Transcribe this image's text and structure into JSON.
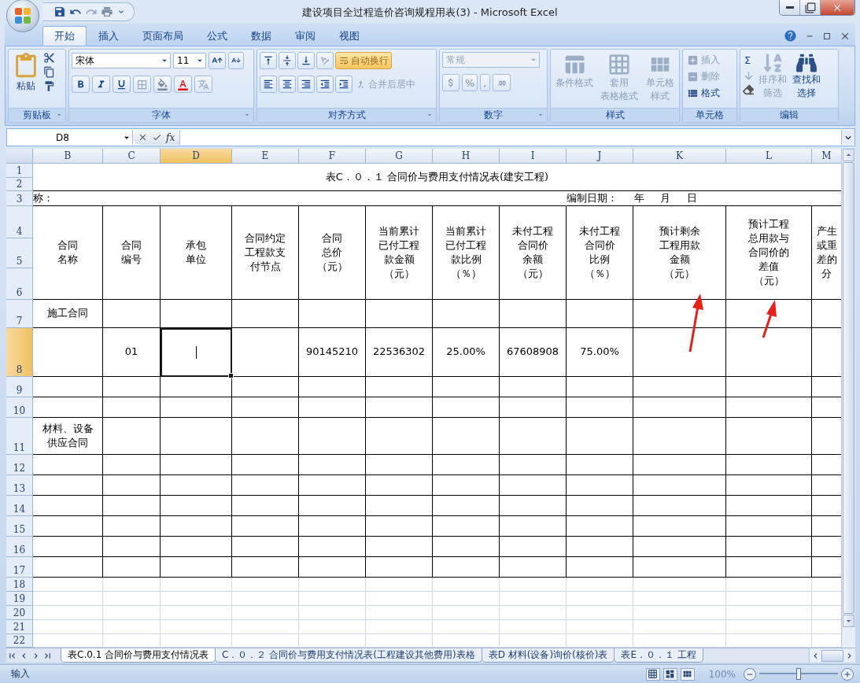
{
  "window": {
    "title": "建设项目全过程造价咨询规程用表(3) - Microsoft Excel"
  },
  "ribbon_tabs": [
    {
      "label": "开始",
      "selected": true
    },
    {
      "label": "插入",
      "selected": false
    },
    {
      "label": "页面布局",
      "selected": false
    },
    {
      "label": "公式",
      "selected": false
    },
    {
      "label": "数据",
      "selected": false
    },
    {
      "label": "审阅",
      "selected": false
    },
    {
      "label": "视图",
      "selected": false
    }
  ],
  "clipboard": {
    "label": "剪贴板",
    "paste": "粘贴"
  },
  "font": {
    "label": "字体",
    "font_name": "宋体",
    "font_size": "11"
  },
  "alignment": {
    "label": "对齐方式",
    "wrap_text": {
      "label": "自动换行",
      "on": true
    },
    "merge": {
      "label": "合并后居中",
      "disabled": true
    }
  },
  "number": {
    "label": "数字",
    "format": "常规",
    "disabled": true,
    "symbols": [
      "%",
      ","
    ]
  },
  "styles": {
    "label": "样式",
    "buttons": [
      {
        "lines": [
          "条件格式"
        ],
        "disabled": true
      },
      {
        "lines": [
          "套用",
          "表格格式"
        ],
        "disabled": true
      },
      {
        "lines": [
          "单元格",
          "样式"
        ],
        "disabled": true
      }
    ]
  },
  "cells": {
    "label": "单元格",
    "buttons": [
      {
        "label": "插入",
        "disabled": true
      },
      {
        "label": "删除",
        "disabled": true
      },
      {
        "label": "格式",
        "disabled": false
      }
    ]
  },
  "editing": {
    "label": "编辑",
    "sum": "Σ",
    "buttons": [
      {
        "lines": [
          "排序和",
          "筛选"
        ],
        "disabled": true
      },
      {
        "lines": [
          "查找和",
          "选择"
        ],
        "disabled": false
      }
    ]
  },
  "formula_bar": {
    "name_box": "D8",
    "function_label": "fx"
  },
  "sheet": {
    "columns": [
      {
        "label": "B",
        "selected": false
      },
      {
        "label": "C",
        "selected": false
      },
      {
        "label": "D",
        "selected": true
      },
      {
        "label": "E",
        "selected": false
      },
      {
        "label": "F",
        "selected": false
      },
      {
        "label": "G",
        "selected": false
      },
      {
        "label": "H",
        "selected": false
      },
      {
        "label": "I",
        "selected": false
      },
      {
        "label": "J",
        "selected": false
      },
      {
        "label": "K",
        "selected": false
      },
      {
        "label": "L",
        "selected": false
      },
      {
        "label": "M",
        "selected": false
      }
    ],
    "rows": [
      {
        "number": "1",
        "selected": false
      },
      {
        "number": "2",
        "selected": false
      },
      {
        "number": "3",
        "selected": false
      },
      {
        "number": "4",
        "selected": false
      },
      {
        "number": "5",
        "selected": false
      },
      {
        "number": "6",
        "selected": false
      },
      {
        "number": "7",
        "selected": false
      },
      {
        "number": "8",
        "selected": true
      },
      {
        "number": "9",
        "selected": false
      },
      {
        "number": "10",
        "selected": false
      },
      {
        "number": "11",
        "selected": false
      },
      {
        "number": "12",
        "selected": false
      },
      {
        "number": "13",
        "selected": false
      },
      {
        "number": "14",
        "selected": false
      },
      {
        "number": "15",
        "selected": false
      },
      {
        "number": "16",
        "selected": false
      },
      {
        "number": "17",
        "selected": false
      },
      {
        "number": "18",
        "selected": false
      },
      {
        "number": "19",
        "selected": false
      },
      {
        "number": "20",
        "selected": false
      },
      {
        "number": "21",
        "selected": false
      },
      {
        "number": "22",
        "selected": false
      }
    ],
    "title": "表C．０．１ 合同价与费用支付情况表(建安工程)",
    "info_left": "称：",
    "info_right": "编制日期：     年     月     日",
    "header": [
      {
        "lines": [
          "合同",
          "名称"
        ]
      },
      {
        "lines": [
          "合同",
          "编号"
        ]
      },
      {
        "lines": [
          "承包",
          "单位"
        ]
      },
      {
        "lines": [
          "合同约定",
          "工程款支",
          "付节点"
        ]
      },
      {
        "lines": [
          "合同",
          "总价",
          "（元）"
        ]
      },
      {
        "lines": [
          "当前累计",
          "已付工程",
          "款金额",
          "（元）"
        ]
      },
      {
        "lines": [
          "当前累计",
          "已付工程",
          "款比例",
          "（％）"
        ]
      },
      {
        "lines": [
          "未付工程",
          "合同价",
          "余额",
          "（元）"
        ]
      },
      {
        "lines": [
          "未付工程",
          "合同价",
          "比例",
          "（％）"
        ]
      },
      {
        "lines": [
          "预计剩余",
          "工程用款",
          "金额",
          "（元）"
        ]
      },
      {
        "lines": [
          "预计工程",
          "总用款与",
          "合同价的",
          "差值",
          "（元）"
        ]
      },
      {
        "lines": [
          "产生",
          "或重",
          "差的",
          "分"
        ]
      }
    ],
    "body": [
      {
        "cells": [
          {
            "lines": [
              "施工合同"
            ]
          },
          null,
          null,
          null,
          null,
          null,
          null,
          null,
          null,
          null,
          null,
          null
        ]
      },
      {
        "cells": [
          null,
          {
            "lines": [
              "01"
            ]
          },
          null,
          null,
          {
            "lines": [
              "90145210"
            ]
          },
          {
            "lines": [
              "22536302"
            ]
          },
          {
            "lines": [
              "25.00%"
            ]
          },
          {
            "lines": [
              "67608908"
            ]
          },
          {
            "lines": [
              "75.00%"
            ]
          },
          null,
          null,
          null
        ]
      },
      {
        "cells": [
          null,
          null,
          null,
          null,
          null,
          null,
          null,
          null,
          null,
          null,
          null,
          null
        ]
      },
      {
        "cells": [
          null,
          null,
          null,
          null,
          null,
          null,
          null,
          null,
          null,
          null,
          null,
          null
        ]
      },
      {
        "cells": [
          {
            "lines": [
              "材料、设备",
              "供应合同"
            ]
          },
          null,
          null,
          null,
          null,
          null,
          null,
          null,
          null,
          null,
          null,
          null
        ]
      }
    ]
  },
  "sheet_tabs": [
    {
      "label": "表C.0.1 合同价与费用支付情况表",
      "selected": true
    },
    {
      "label": "C．０．２ 合同价与费用支付情况表(工程建设其他费用)表格",
      "selected": false
    },
    {
      "label": "表D 材料(设备)询价(核价)表",
      "selected": false
    },
    {
      "label": "表E．０．１ 工程",
      "selected": false
    }
  ],
  "status_bar": {
    "mode": "输入",
    "zoom": "100%",
    "zoom_level": {
      "level": 0.5
    }
  }
}
